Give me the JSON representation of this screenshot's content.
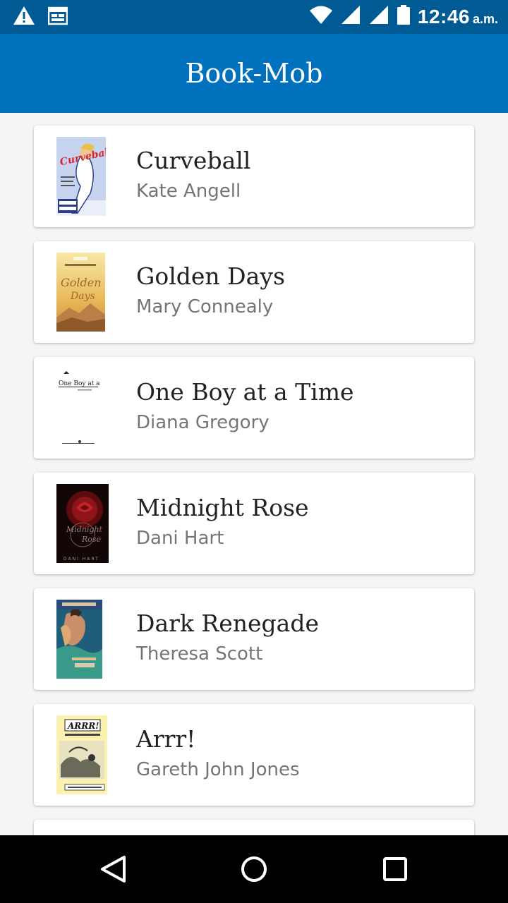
{
  "status_bar": {
    "time": "12:46",
    "ampm": "a.m.",
    "icons": [
      "warning-icon",
      "calendar-icon",
      "wifi-icon",
      "signal-icon",
      "signal-icon-2",
      "battery-icon"
    ]
  },
  "app_bar": {
    "title": "Book-Mob"
  },
  "books": [
    {
      "title": "Curveball",
      "author": "Kate Angell",
      "cover_color": "#c7d4ef"
    },
    {
      "title": "Golden Days",
      "author": "Mary Connealy",
      "cover_color": "#e8c56a"
    },
    {
      "title": "One Boy at a Time",
      "author": "Diana Gregory",
      "cover_color": "#ffffff"
    },
    {
      "title": "Midnight Rose",
      "author": "Dani Hart",
      "cover_color": "#1a0a0a"
    },
    {
      "title": "Dark Renegade",
      "author": "Theresa Scott",
      "cover_color": "#2f7f86"
    },
    {
      "title": "Arrr!",
      "author": "Gareth John Jones",
      "cover_color": "#fbf1b0"
    }
  ],
  "nav_bar": {
    "icons": [
      "back-icon",
      "home-icon",
      "recents-icon"
    ]
  }
}
